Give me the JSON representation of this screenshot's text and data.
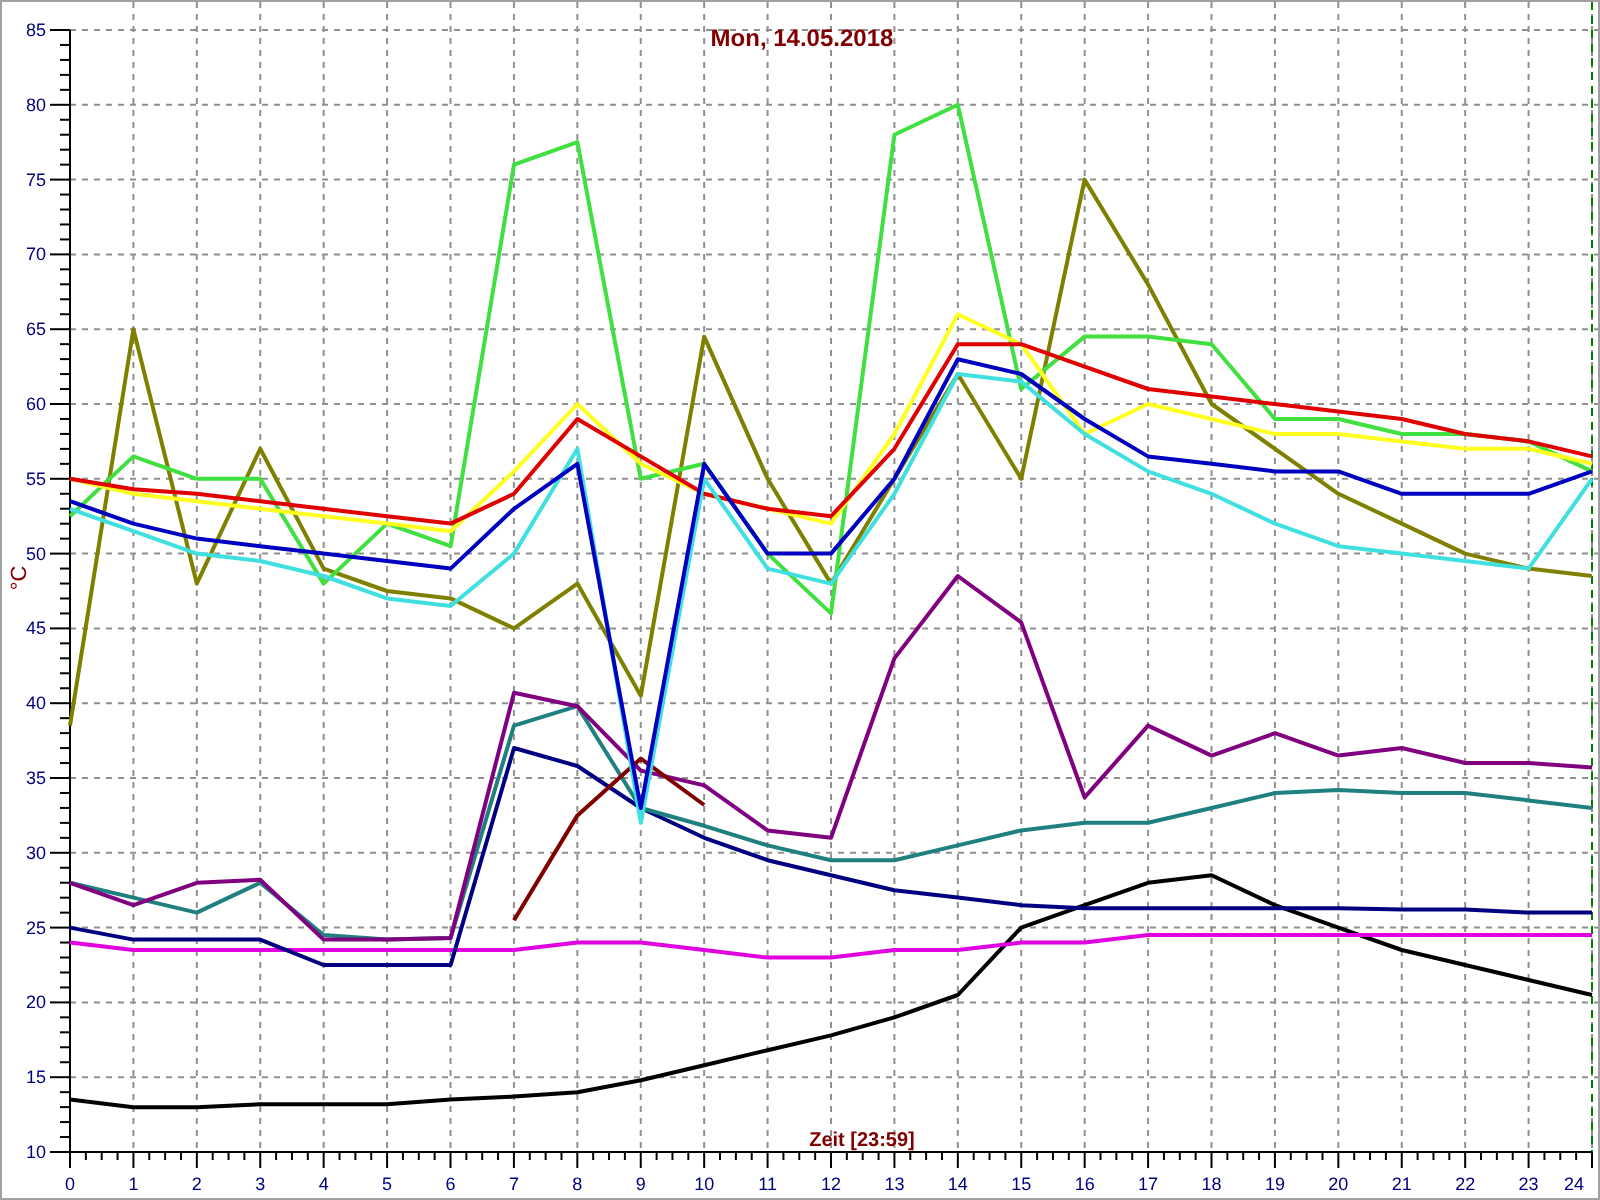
{
  "chart": {
    "chart_data": {
      "type": "line",
      "title": "Mon, 14.05.2018",
      "xlabel": "Zeit [23:59]",
      "ylabel": "°C",
      "x": [
        0,
        1,
        2,
        3,
        4,
        5,
        6,
        7,
        8,
        9,
        10,
        11,
        12,
        13,
        14,
        15,
        16,
        17,
        18,
        19,
        20,
        21,
        22,
        23,
        24
      ],
      "grid": true,
      "xlim": [
        0,
        24
      ],
      "ylim": [
        10,
        85
      ],
      "xticks": [
        0,
        1,
        2,
        3,
        4,
        5,
        6,
        7,
        8,
        9,
        10,
        11,
        12,
        13,
        14,
        15,
        16,
        17,
        18,
        19,
        20,
        21,
        22,
        23,
        24
      ],
      "yticks": [
        10,
        15,
        20,
        25,
        30,
        35,
        40,
        45,
        50,
        55,
        60,
        65,
        70,
        75,
        80,
        85
      ],
      "series": [
        {
          "color": "#000000",
          "values": [
            13.5,
            13,
            13,
            13.2,
            13.2,
            13.2,
            13.5,
            13.7,
            14,
            14.8,
            15.8,
            16.8,
            17.8,
            19,
            20.5,
            25,
            26.5,
            28,
            28.5,
            26.5,
            25,
            23.5,
            22.5,
            21.5,
            20.5
          ]
        },
        {
          "color": "#e000e0",
          "values": [
            24,
            23.5,
            23.5,
            23.5,
            23.5,
            23.5,
            23.5,
            23.5,
            24,
            24,
            23.5,
            23,
            23,
            23.5,
            23.5,
            24,
            24,
            24.5,
            24.5,
            24.5,
            24.5,
            24.5,
            24.5,
            24.5,
            24.5
          ]
        },
        {
          "color": "#000080",
          "values": [
            25,
            24.2,
            24.2,
            24.2,
            22.5,
            22.5,
            22.5,
            37,
            35.8,
            33,
            31,
            29.5,
            28.5,
            27.5,
            27,
            26.5,
            26.3,
            26.3,
            26.3,
            26.3,
            26.3,
            26.2,
            26.2,
            26,
            26
          ]
        },
        {
          "color": "#208080",
          "values": [
            28,
            27,
            26,
            28,
            24.5,
            24.2,
            24.3,
            38.5,
            39.8,
            33,
            31.8,
            30.5,
            29.5,
            29.5,
            30.5,
            31.5,
            32,
            32,
            33,
            34,
            34.2,
            34,
            34,
            33.5,
            33
          ]
        },
        {
          "color": "#800080",
          "values": [
            28,
            26.5,
            28,
            28.2,
            24.2,
            24.2,
            24.3,
            40.7,
            39.8,
            35.5,
            34.5,
            31.5,
            31,
            43,
            48.5,
            45.4,
            33.7,
            38.5,
            36.5,
            38,
            36.5,
            37,
            36,
            36,
            35.7
          ]
        },
        {
          "color": "#800000",
          "values": [
            null,
            null,
            null,
            null,
            null,
            null,
            null,
            25.5,
            32.5,
            36.3,
            33.2,
            null,
            null,
            null,
            null,
            null,
            null,
            null,
            null,
            null,
            null,
            null,
            null,
            null,
            null
          ]
        },
        {
          "color": "#808000",
          "values": [
            38.5,
            65,
            48,
            57,
            49,
            47.5,
            47,
            45,
            48,
            40.5,
            64.5,
            55,
            48,
            55,
            62,
            55,
            75,
            68,
            60,
            57,
            54,
            52,
            50,
            49,
            48.5
          ]
        },
        {
          "color": "#40e040",
          "values": [
            52.5,
            56.5,
            55,
            55,
            48,
            52,
            50.5,
            76,
            77.5,
            55,
            56,
            50,
            46,
            78,
            80,
            61,
            64.5,
            64.5,
            64,
            59,
            59,
            58,
            58,
            57.5,
            55.5
          ]
        },
        {
          "color": "#ffff20",
          "values": [
            55,
            54,
            53.5,
            53,
            52.5,
            52,
            51.5,
            55.5,
            60,
            56,
            54,
            53,
            52,
            58,
            66,
            64,
            58,
            60,
            59,
            58,
            58,
            57.5,
            57,
            57,
            56
          ]
        },
        {
          "color": "#e00000",
          "values": [
            55,
            54.3,
            54,
            53.5,
            53,
            52.5,
            52,
            54,
            59,
            56.5,
            54,
            53,
            52.5,
            57,
            64,
            64,
            62.5,
            61,
            60.5,
            60,
            59.5,
            59,
            58,
            57.5,
            56.5
          ]
        },
        {
          "color": "#40e0e0",
          "values": [
            53,
            51.5,
            50,
            49.5,
            48.5,
            47,
            46.5,
            50,
            57,
            32,
            55,
            49,
            48,
            54,
            62,
            61.5,
            58,
            55.5,
            54,
            52,
            50.5,
            50,
            49.5,
            49,
            55
          ]
        },
        {
          "color": "#0000c0",
          "values": [
            53.5,
            52,
            51,
            50.5,
            50,
            49.5,
            49,
            53,
            56,
            33,
            56,
            50,
            50,
            55,
            63,
            62,
            59,
            56.5,
            56,
            55.5,
            55.5,
            54,
            54,
            54,
            55.5
          ]
        }
      ]
    }
  }
}
